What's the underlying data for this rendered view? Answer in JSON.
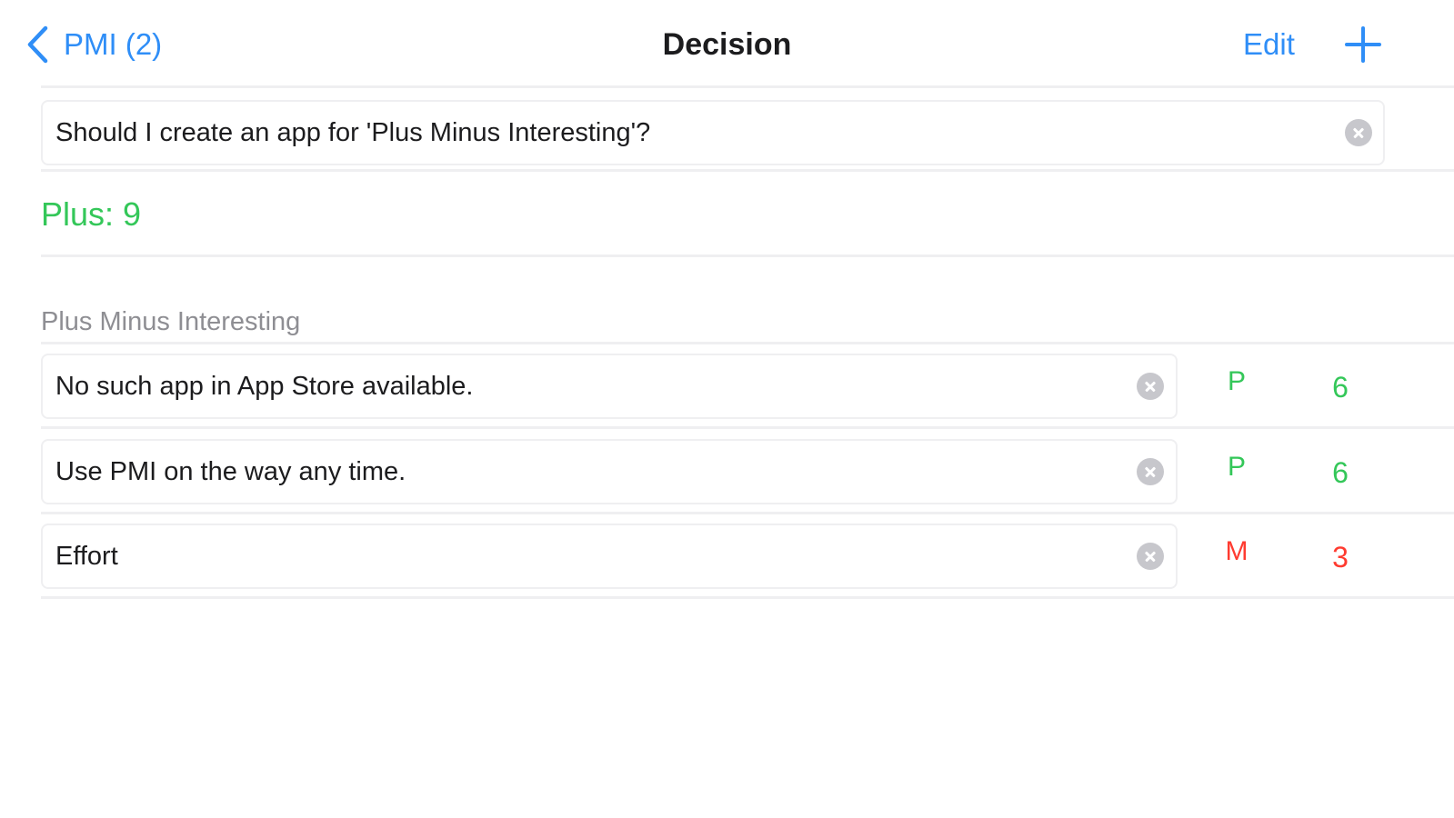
{
  "colors": {
    "accent": "#2f8ef7",
    "plus": "#34c759",
    "minus": "#ff3b30",
    "secondary_text": "#8e8e93"
  },
  "nav": {
    "back_label": "PMI (2)",
    "title": "Decision",
    "edit_label": "Edit",
    "back_icon": "chevron-left-icon",
    "add_icon": "plus-icon"
  },
  "question": {
    "value": "Should I create an app for 'Plus Minus Interesting'?",
    "clear_icon": "clear-circle-icon"
  },
  "summary": {
    "text": "Plus: 9",
    "color": "#34c759"
  },
  "section": {
    "header": "Plus Minus Interesting"
  },
  "items": [
    {
      "text": "No such app in App Store available.",
      "type": "P",
      "score": "6",
      "color": "#34c759"
    },
    {
      "text": "Use PMI on the way any time.",
      "type": "P",
      "score": "6",
      "color": "#34c759"
    },
    {
      "text": "Effort",
      "type": "M",
      "score": "3",
      "color": "#ff3b30"
    }
  ]
}
